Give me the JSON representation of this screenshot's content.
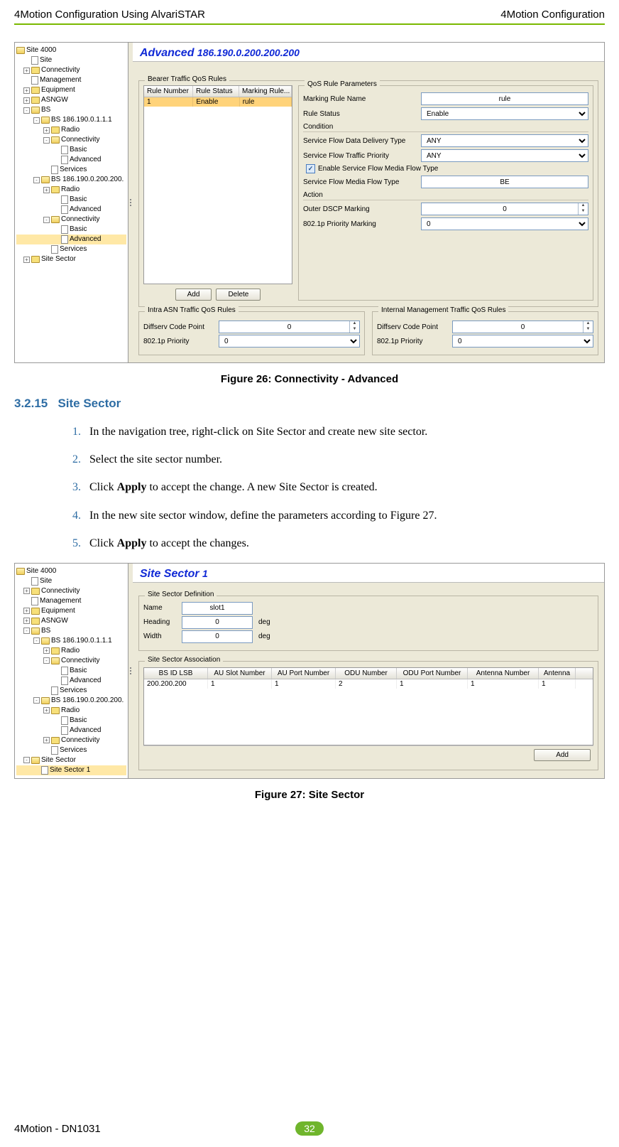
{
  "header": {
    "left": "4Motion Configuration Using AlvariSTAR",
    "right": "4Motion Configuration"
  },
  "fig26": {
    "tree": {
      "root": "Site 4000",
      "items": [
        {
          "lvl": 1,
          "icon": "page",
          "label": "Site"
        },
        {
          "lvl": 1,
          "icon": "folder",
          "exp": "+",
          "label": "Connectivity"
        },
        {
          "lvl": 1,
          "icon": "page",
          "label": "Management"
        },
        {
          "lvl": 1,
          "icon": "folder",
          "exp": "+",
          "label": "Equipment"
        },
        {
          "lvl": 1,
          "icon": "folder",
          "exp": "+",
          "label": "ASNGW"
        },
        {
          "lvl": 1,
          "icon": "folder",
          "exp": "-",
          "label": "BS"
        },
        {
          "lvl": 2,
          "icon": "folder",
          "exp": "-",
          "label": "BS 186.190.0.1.1.1"
        },
        {
          "lvl": 3,
          "icon": "folder",
          "exp": "+",
          "label": "Radio"
        },
        {
          "lvl": 3,
          "icon": "folder",
          "exp": "-",
          "label": "Connectivity"
        },
        {
          "lvl": 4,
          "icon": "page",
          "label": "Basic"
        },
        {
          "lvl": 4,
          "icon": "page",
          "label": "Advanced"
        },
        {
          "lvl": 3,
          "icon": "page",
          "label": "Services"
        },
        {
          "lvl": 2,
          "icon": "folder",
          "exp": "-",
          "label": "BS 186.190.0.200.200."
        },
        {
          "lvl": 3,
          "icon": "folder",
          "exp": "+",
          "label": "Radio"
        },
        {
          "lvl": 4,
          "icon": "page",
          "label": "Basic"
        },
        {
          "lvl": 4,
          "icon": "page",
          "label": "Advanced"
        },
        {
          "lvl": 3,
          "icon": "folder",
          "exp": "-",
          "label": "Connectivity"
        },
        {
          "lvl": 4,
          "icon": "page",
          "label": "Basic"
        },
        {
          "lvl": 4,
          "icon": "page",
          "label": "Advanced",
          "selected": true
        },
        {
          "lvl": 3,
          "icon": "page",
          "label": "Services"
        },
        {
          "lvl": 1,
          "icon": "folder",
          "exp": "+",
          "label": "Site Sector"
        }
      ]
    },
    "title_main": "Advanced",
    "title_ip": "186.190.0.200.200.200",
    "bearer_label": "Bearer Traffic QoS Rules",
    "rules_head": {
      "a": "Rule Number",
      "b": "Rule Status",
      "c": "Marking Rule..."
    },
    "rules_row": {
      "a": "1",
      "b": "Enable",
      "c": "rule"
    },
    "qos_label": "QoS Rule Parameters",
    "marking_name_label": "Marking Rule Name",
    "marking_name_value": "rule",
    "rule_status_label": "Rule Status",
    "rule_status_value": "Enable",
    "condition_label": "Condition",
    "sfddt_label": "Service Flow Data Delivery Type",
    "sfddt_value": "ANY",
    "sftp_label": "Service Flow Traffic Priority",
    "sftp_value": "ANY",
    "enable_sf_label": "Enable Service Flow Media Flow Type",
    "sfmft_label": "Service Flow Media Flow Type",
    "sfmft_value": "BE",
    "action_label": "Action",
    "odscp_label": "Outer DSCP Marking",
    "odscp_value": "0",
    "p8021_label": "802.1p Priority Marking",
    "p8021_value": "0",
    "add_label": "Add",
    "delete_label": "Delete",
    "intra_label": "Intra ASN Traffic QoS Rules",
    "internal_label": "Internal Management Traffic QoS Rules",
    "dscp_label": "Diffserv Code Point",
    "dscp_value": "0",
    "p8021p_label": "802.1p Priority",
    "p8021p_value": "0",
    "caption": "Figure 26: Connectivity - Advanced"
  },
  "section": {
    "num": "3.2.15",
    "title": "Site Sector"
  },
  "steps": [
    {
      "n": "1.",
      "t": "In the navigation tree, right-click on Site Sector and create new site sector."
    },
    {
      "n": "2.",
      "t": "Select the site sector number."
    },
    {
      "n": "3.",
      "pre": "Click ",
      "bold": "Apply",
      "post": " to accept the change. A new Site Sector is created."
    },
    {
      "n": "4.",
      "t": "In the new site sector window, define the parameters according to Figure 27."
    },
    {
      "n": "5.",
      "pre": "Click ",
      "bold": "Apply",
      "post": " to accept the changes."
    }
  ],
  "fig27": {
    "tree": {
      "root": "Site 4000",
      "items": [
        {
          "lvl": 1,
          "icon": "page",
          "label": "Site"
        },
        {
          "lvl": 1,
          "icon": "folder",
          "exp": "+",
          "label": "Connectivity"
        },
        {
          "lvl": 1,
          "icon": "page",
          "label": "Management"
        },
        {
          "lvl": 1,
          "icon": "folder",
          "exp": "+",
          "label": "Equipment"
        },
        {
          "lvl": 1,
          "icon": "folder",
          "exp": "+",
          "label": "ASNGW"
        },
        {
          "lvl": 1,
          "icon": "folder",
          "exp": "-",
          "label": "BS"
        },
        {
          "lvl": 2,
          "icon": "folder",
          "exp": "-",
          "label": "BS 186.190.0.1.1.1"
        },
        {
          "lvl": 3,
          "icon": "folder",
          "exp": "+",
          "label": "Radio"
        },
        {
          "lvl": 3,
          "icon": "folder",
          "exp": "-",
          "label": "Connectivity"
        },
        {
          "lvl": 4,
          "icon": "page",
          "label": "Basic"
        },
        {
          "lvl": 4,
          "icon": "page",
          "label": "Advanced"
        },
        {
          "lvl": 3,
          "icon": "page",
          "label": "Services"
        },
        {
          "lvl": 2,
          "icon": "folder",
          "exp": "-",
          "label": "BS 186.190.0.200.200."
        },
        {
          "lvl": 3,
          "icon": "folder",
          "exp": "+",
          "label": "Radio"
        },
        {
          "lvl": 4,
          "icon": "page",
          "label": "Basic"
        },
        {
          "lvl": 4,
          "icon": "page",
          "label": "Advanced"
        },
        {
          "lvl": 3,
          "icon": "folder",
          "exp": "+",
          "label": "Connectivity"
        },
        {
          "lvl": 3,
          "icon": "page",
          "label": "Services"
        },
        {
          "lvl": 1,
          "icon": "folder",
          "exp": "-",
          "label": "Site Sector"
        },
        {
          "lvl": 2,
          "icon": "page",
          "label": "Site Sector 1",
          "selected": true
        }
      ]
    },
    "title_main": "Site Sector",
    "title_num": "1",
    "def_label": "Site Sector Definition",
    "name_label": "Name",
    "name_value": "slot1",
    "heading_label": "Heading",
    "heading_value": "0",
    "width_label": "Width",
    "width_value": "0",
    "deg": "deg",
    "assoc_label": "Site Sector Association",
    "assoc_head": {
      "c1": "BS ID LSB",
      "c2": "AU Slot Number",
      "c3": "AU Port Number",
      "c4": "ODU Number",
      "c5": "ODU Port Number",
      "c6": "Antenna Number",
      "c7": "Antenna"
    },
    "assoc_row": {
      "c1": "200.200.200",
      "c2": "1",
      "c3": "1",
      "c4": "2",
      "c5": "1",
      "c6": "1",
      "c7": "1"
    },
    "add_label": "Add",
    "caption": "Figure 27: Site Sector"
  },
  "footer": {
    "left": "4Motion - DN1031",
    "page": "32"
  }
}
